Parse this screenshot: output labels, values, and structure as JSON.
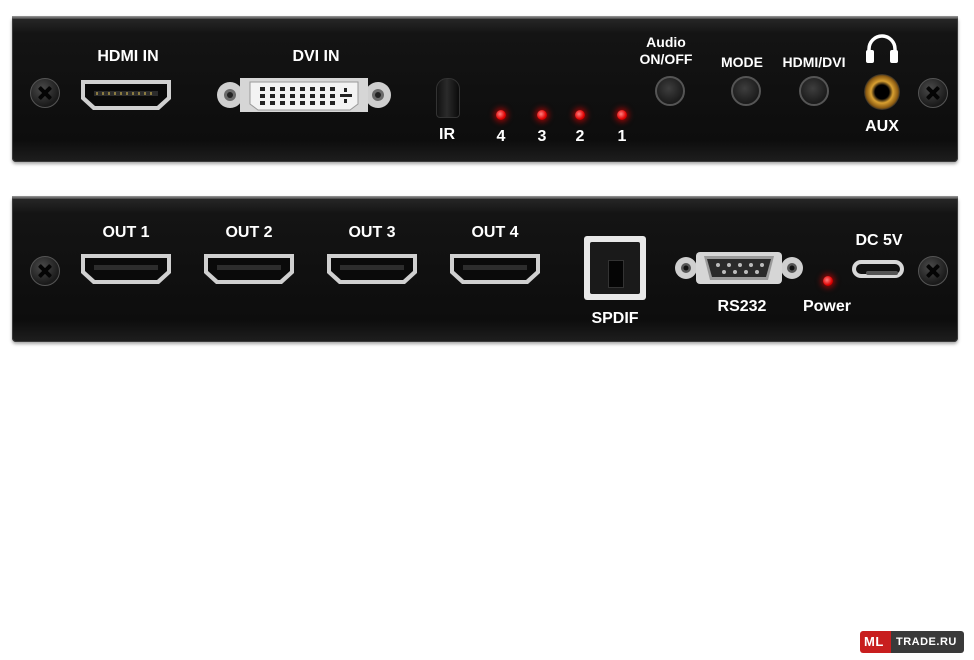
{
  "top_panel": {
    "hdmi_in_label": "HDMI IN",
    "dvi_in_label": "DVI IN",
    "ir_label": "IR",
    "led_labels": [
      "4",
      "3",
      "2",
      "1"
    ],
    "audio_label_line1": "Audio",
    "audio_label_line2": "ON/OFF",
    "mode_label": "MODE",
    "hdmi_dvi_label": "HDMI/DVI",
    "aux_label": "AUX",
    "headphone_icon": "headphones-icon"
  },
  "bottom_panel": {
    "outputs": [
      "OUT 1",
      "OUT 2",
      "OUT 3",
      "OUT 4"
    ],
    "spdif_label": "SPDIF",
    "rs232_label": "RS232",
    "power_label": "Power",
    "dc_label": "DC 5V"
  },
  "watermark": {
    "logo_left": "ML",
    "logo_right": "TRADE.RU"
  },
  "colors": {
    "panel": "#111111",
    "label_text": "#ffffff",
    "led_red": "#ff1a1a",
    "aux_gold": "#d9a031"
  }
}
